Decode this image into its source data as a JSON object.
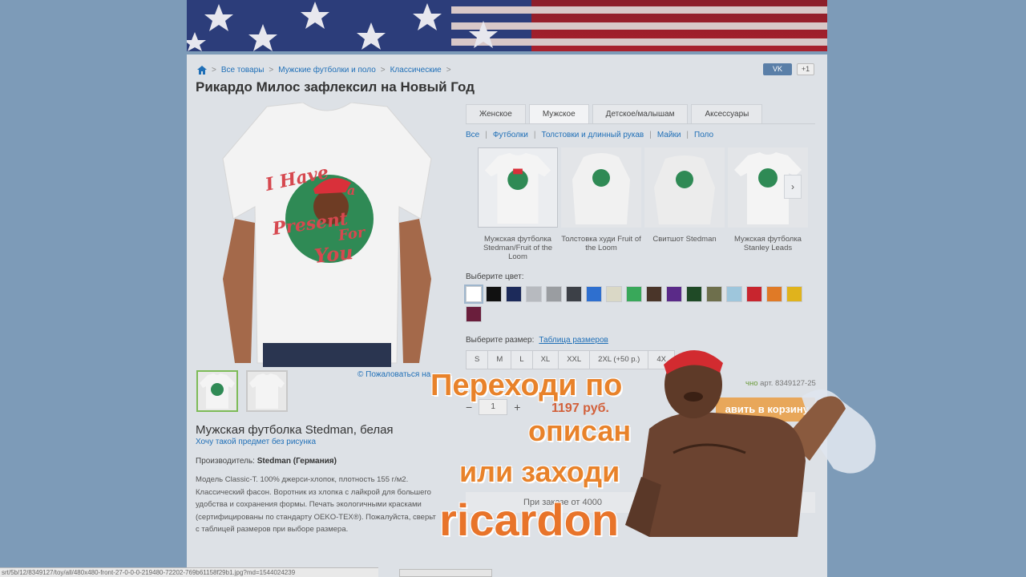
{
  "breadcrumb": {
    "items": [
      "Все товары",
      "Мужские футболки и поло",
      "Классические"
    ]
  },
  "title": "Рикардо Милос зафлексил на Новый Год",
  "share": {
    "vk": "VK",
    "plusone": "+1"
  },
  "main_image": {
    "print_text": [
      "I Have",
      "a",
      "Present",
      "For",
      "You"
    ]
  },
  "complain_link": "© Пожаловаться на",
  "product": {
    "name": "Мужская футболка Stedman, белая",
    "link": "Хочу такой предмет без рисунка",
    "maker_label": "Производитель:",
    "maker_value": "Stedman (Германия)",
    "description": "Модель Classic-T. 100% джерси-хлопок, плотность 155 г/м2. Классический фасон. Воротник из хлопка с лайкрой для большего удобства и сохранения формы. Печать экологичными красками (сертифицированы по стандарту OEKO-TEX®). Пожалуйста, сверьт с таблицей размеров при выборе размера."
  },
  "tabs": [
    "Женское",
    "Мужское",
    "Детское/малышам",
    "Аксессуары"
  ],
  "subnav": [
    "Все",
    "Футболки",
    "Толстовки и длинный рукав",
    "Майки",
    "Поло"
  ],
  "carousel": [
    {
      "label": "Мужская футболка Stedman/Fruit of the Loom"
    },
    {
      "label": "Толстовка худи Fruit of the Loom"
    },
    {
      "label": "Свитшот Stedman"
    },
    {
      "label": "Мужская футболка Stanley Leads"
    }
  ],
  "color_label": "Выберите цвет:",
  "colors": [
    "#ffffff",
    "#111111",
    "#1c2a5a",
    "#b7babf",
    "#9a9da1",
    "#3c4047",
    "#2e6fcf",
    "#dad8c6",
    "#39a85a",
    "#4a3529",
    "#5a2a88",
    "#1f4a26",
    "#6e6f4c",
    "#9ec6dc",
    "#c8252e",
    "#e07a26",
    "#e0b31c",
    "#6a1e3c"
  ],
  "size_label": "Выберите размер:",
  "size_table": "Таблица размеров",
  "sizes": [
    "S",
    "M",
    "L",
    "XL",
    "XXL",
    "2XL (+50 р.)",
    "4X"
  ],
  "article": "арт. 8349127-25",
  "availability": "чно",
  "qty": {
    "minus": "−",
    "value": "1",
    "plus": "+"
  },
  "price": "1197 руб.",
  "cart_button": "авить в корзину",
  "order_strip": "При заказе от 4000",
  "statusbar": "srt/5b/12/8349127/toy/all/480x480-front-27-0-0-0-219480-72202-769b61158f29b1.jpg?md=1544024239",
  "overlay": {
    "line1": "Переходи по",
    "line2": "описан",
    "line3": "или заходи",
    "line4": "ricardon"
  }
}
